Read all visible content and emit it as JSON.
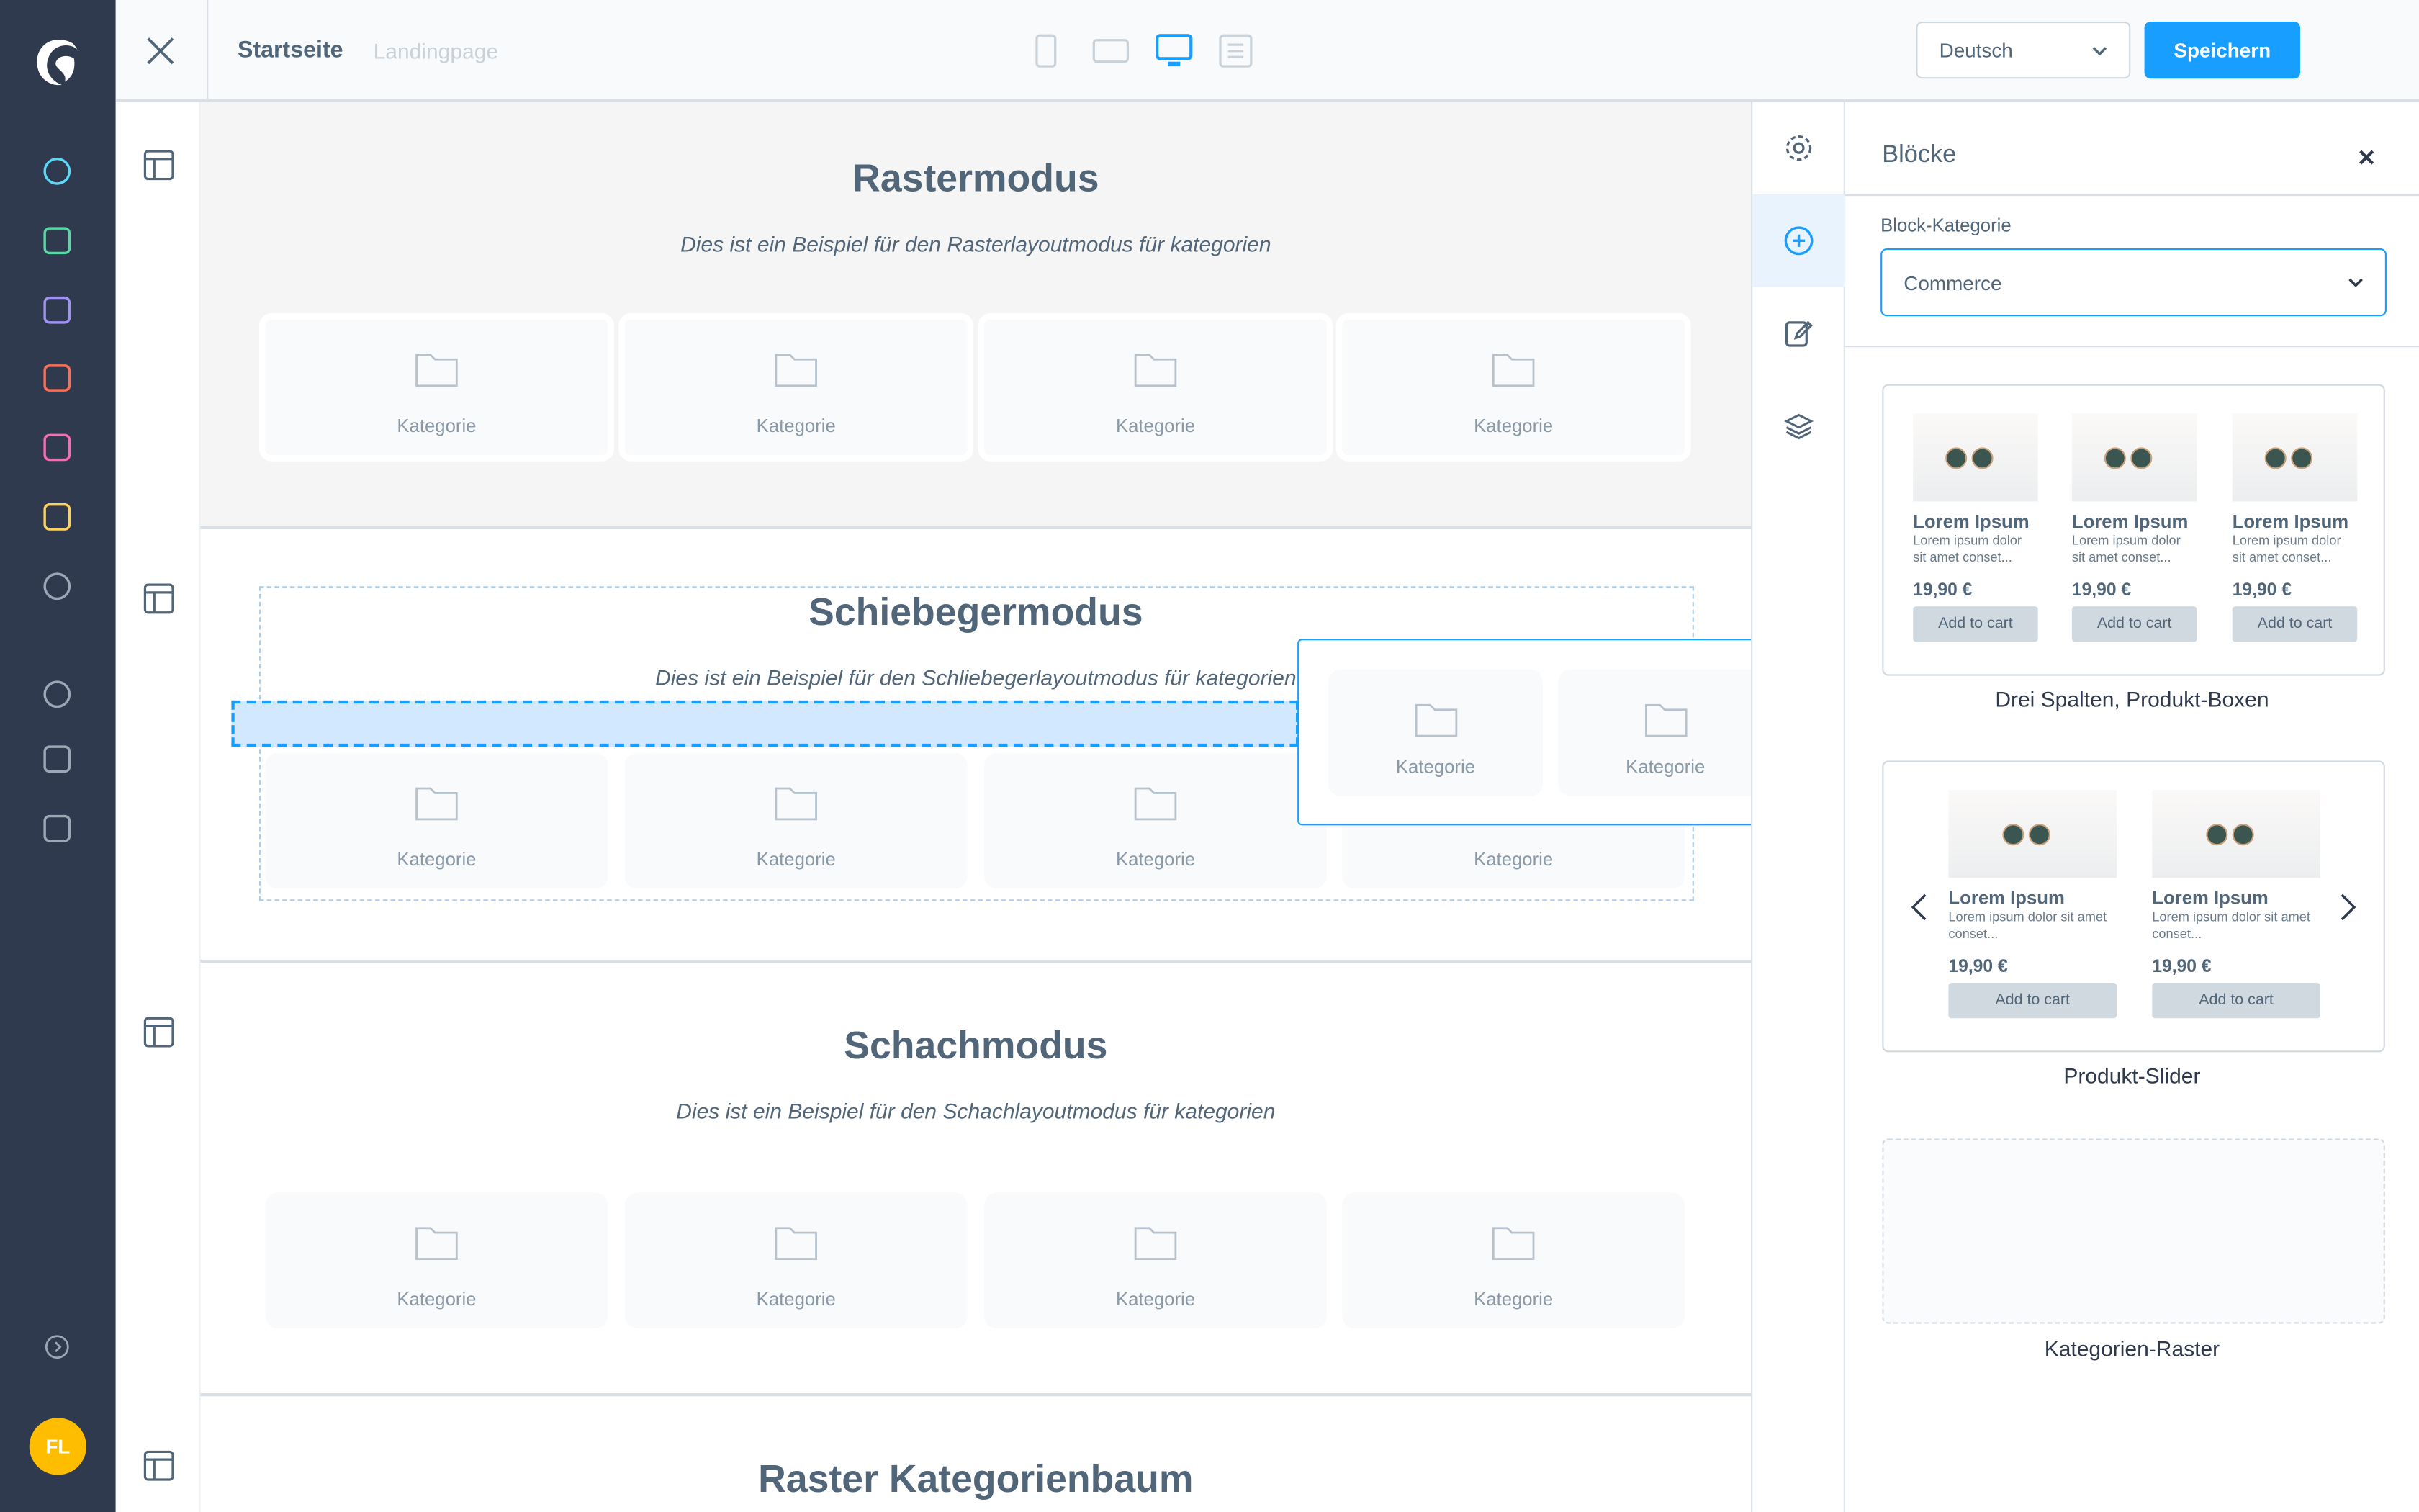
{
  "topbar": {
    "title": "Startseite",
    "subtitle": "Landingpage",
    "language": "Deutsch",
    "save_label": "Speichern",
    "devices": [
      "mobile-icon",
      "tablet-icon",
      "desktop-icon",
      "list-icon"
    ],
    "active_device": "desktop-icon"
  },
  "sidebar": {
    "icons": [
      {
        "name": "dashboard-icon",
        "color": "#57d9f7"
      },
      {
        "name": "catalog-icon",
        "color": "#57d9a3"
      },
      {
        "name": "orders-icon",
        "color": "#a092f0"
      },
      {
        "name": "customers-icon",
        "color": "#ff6e52"
      },
      {
        "name": "content-icon",
        "color": "#ff68b4"
      },
      {
        "name": "marketing-icon",
        "color": "#ffd154"
      },
      {
        "name": "settings-icon",
        "color": "#9aa8b5"
      },
      {
        "name": "plus-circle-icon",
        "color": "#9aa8b5"
      },
      {
        "name": "store-icon",
        "color": "#9aa8b5"
      },
      {
        "name": "basket-icon",
        "color": "#9aa8b5"
      }
    ],
    "user_initials": "FL",
    "avatar_color": "#ffbd00"
  },
  "canvas": {
    "category_label": "Kategorie",
    "sections": [
      {
        "title": "Rastermodus",
        "description": "Dies ist ein Beispiel für den Rasterlayoutmodus für kategorien"
      },
      {
        "title": "Schiebegermodus",
        "description": "Dies ist ein Beispiel für den Schliebegerlayoutmodus für kategorien"
      },
      {
        "title": "Schachmodus",
        "description": "Dies ist ein Beispiel für den Schachlayoutmodus für kategorien"
      },
      {
        "title": "Raster Kategorienbaum",
        "description": ""
      }
    ]
  },
  "panel": {
    "title": "Blöcke",
    "category_label": "Block-Kategorie",
    "category_value": "Commerce",
    "product": {
      "name": "Lorem Ipsum",
      "desc3": "Lorem ipsum dolor sit amet conset...",
      "desc2": "Lorem ipsum dolor sit amet conset...",
      "price": "19,90 €",
      "cta": "Add to cart"
    },
    "blocks": [
      "Drei Spalten, Produkt-Boxen",
      "Produkt-Slider",
      "Kategorien-Raster"
    ]
  },
  "accent": "#189eff"
}
